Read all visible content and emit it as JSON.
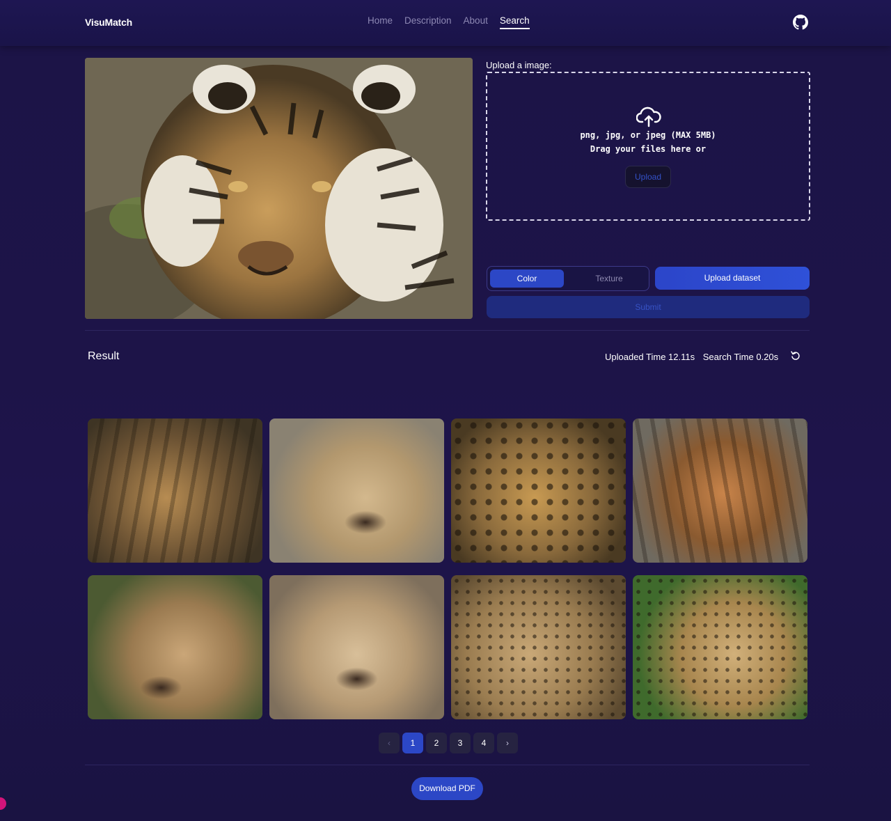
{
  "header": {
    "brand": "VisuMatch",
    "nav": [
      "Home",
      "Description",
      "About",
      "Search"
    ],
    "active_nav": "Search",
    "github_icon": "github-icon"
  },
  "upload": {
    "label": "Upload a image:",
    "formats": "png, jpg, or jpeg (MAX 5MB)",
    "drag_text": "Drag your files here or",
    "button": "Upload",
    "icon": "cloud-upload-icon"
  },
  "controls": {
    "mode_options": [
      "Color",
      "Texture"
    ],
    "selected_mode": "Color",
    "dataset_button": "Upload dataset",
    "submit_button": "Submit"
  },
  "result": {
    "title": "Result",
    "uploaded_time": "Uploaded Time 12.11s",
    "search_time": "Search Time 0.20s",
    "refresh_icon": "refresh-icon",
    "images": [
      {
        "subject": "tiger"
      },
      {
        "subject": "lioness"
      },
      {
        "subject": "jaguar"
      },
      {
        "subject": "tiger"
      },
      {
        "subject": "lioness"
      },
      {
        "subject": "lioness"
      },
      {
        "subject": "cheetah"
      },
      {
        "subject": "cheetah"
      }
    ]
  },
  "pagination": {
    "prev": "‹",
    "pages": [
      "1",
      "2",
      "3",
      "4"
    ],
    "current": "1",
    "next": "›"
  },
  "footer": {
    "download_button": "Download PDF"
  },
  "colors": {
    "accent": "#2c47c6",
    "background": "#1d1448"
  }
}
